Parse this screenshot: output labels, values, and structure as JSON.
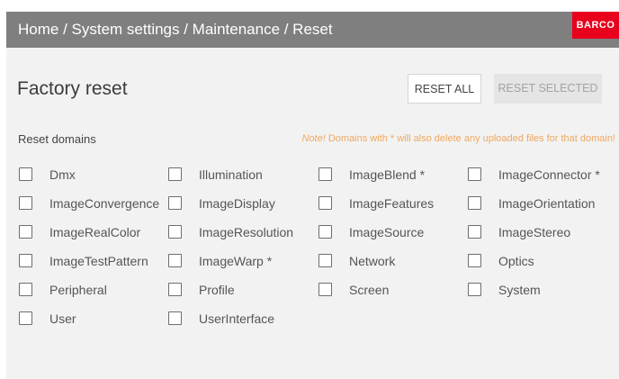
{
  "header": {
    "breadcrumb": "Home / System settings / Maintenance / Reset",
    "brand": "BARCO",
    "background": "#7f7f7f",
    "brand_color": "#e8001c"
  },
  "page": {
    "title": "Factory reset"
  },
  "buttons": {
    "reset_all": "RESET ALL",
    "reset_selected": "RESET SELECTED"
  },
  "domains_section": {
    "label": "Reset domains",
    "note_prefix": "Note!",
    "note_text": " Domains with * will also delete any uploaded files for that domain!",
    "note_color": "#f0a860"
  },
  "domains": [
    {
      "label": "Dmx",
      "checked": false
    },
    {
      "label": "Illumination",
      "checked": false
    },
    {
      "label": "ImageBlend *",
      "checked": false
    },
    {
      "label": "ImageConnector *",
      "checked": false
    },
    {
      "label": "ImageConvergence",
      "checked": false
    },
    {
      "label": "ImageDisplay",
      "checked": false
    },
    {
      "label": "ImageFeatures",
      "checked": false
    },
    {
      "label": "ImageOrientation",
      "checked": false
    },
    {
      "label": "ImageRealColor",
      "checked": false
    },
    {
      "label": "ImageResolution",
      "checked": false
    },
    {
      "label": "ImageSource",
      "checked": false
    },
    {
      "label": "ImageStereo",
      "checked": false
    },
    {
      "label": "ImageTestPattern",
      "checked": false
    },
    {
      "label": "ImageWarp *",
      "checked": false
    },
    {
      "label": "Network",
      "checked": false
    },
    {
      "label": "Optics",
      "checked": false
    },
    {
      "label": "Peripheral",
      "checked": false
    },
    {
      "label": "Profile",
      "checked": false
    },
    {
      "label": "Screen",
      "checked": false
    },
    {
      "label": "System",
      "checked": false
    },
    {
      "label": "User",
      "checked": false
    },
    {
      "label": "UserInterface",
      "checked": false
    }
  ]
}
